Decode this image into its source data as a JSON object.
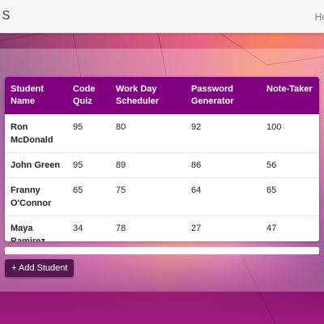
{
  "navbar": {
    "brand": "ıs",
    "nav_link": "Ho"
  },
  "table": {
    "headers": [
      "Student Name",
      "Code Quiz",
      "Work Day Scheduler",
      "Password Generator",
      "Note-Taker"
    ],
    "rows": [
      {
        "name": "Ron McDonald",
        "scores": [
          "95",
          "80",
          "92",
          "100"
        ]
      },
      {
        "name": "John Green",
        "scores": [
          "95",
          "89",
          "86",
          "56"
        ]
      },
      {
        "name": "Franny O'Connor",
        "scores": [
          "65",
          "75",
          "64",
          "65"
        ]
      },
      {
        "name": "Maya Ramirez",
        "scores": [
          "34",
          "78",
          "27",
          "47"
        ]
      }
    ]
  },
  "actions": {
    "add_student_label": "+ Add Student"
  },
  "colors": {
    "header_purple": "#800080",
    "button_purple": "#54164f"
  }
}
